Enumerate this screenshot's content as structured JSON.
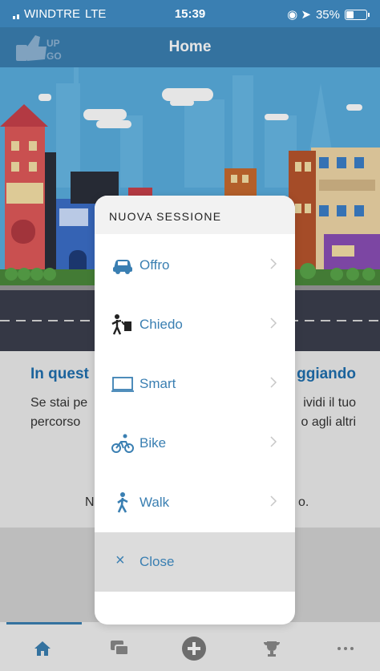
{
  "status_bar": {
    "carrier": "WINDTRE",
    "network": "LTE",
    "time": "15:39",
    "battery": "35%"
  },
  "nav": {
    "title": "Home",
    "logo_top": "UP",
    "logo_bottom": "GO"
  },
  "content": {
    "heading_left": "In quest",
    "heading_right": "ggiando",
    "line1_left": "Se stai pe",
    "line1_right": "ividi il tuo",
    "line2_left": "percorso",
    "line2_right": "o agli altri",
    "line3_left": "N",
    "line3_right": "o."
  },
  "sheet": {
    "title": "NUOVA SESSIONE",
    "items": [
      {
        "label": "Offro",
        "icon": "car-icon"
      },
      {
        "label": "Chiedo",
        "icon": "hitchhike-icon"
      },
      {
        "label": "Smart",
        "icon": "laptop-icon"
      },
      {
        "label": "Bike",
        "icon": "bike-icon"
      },
      {
        "label": "Walk",
        "icon": "walk-icon"
      }
    ],
    "close_label": "Close"
  },
  "tabs": [
    {
      "name": "home-icon"
    },
    {
      "name": "chat-icon"
    },
    {
      "name": "add-icon"
    },
    {
      "name": "trophy-icon"
    },
    {
      "name": "more-icon"
    }
  ],
  "colors": {
    "brand": "#3a7fb2",
    "accent_text": "#1f6fae"
  }
}
